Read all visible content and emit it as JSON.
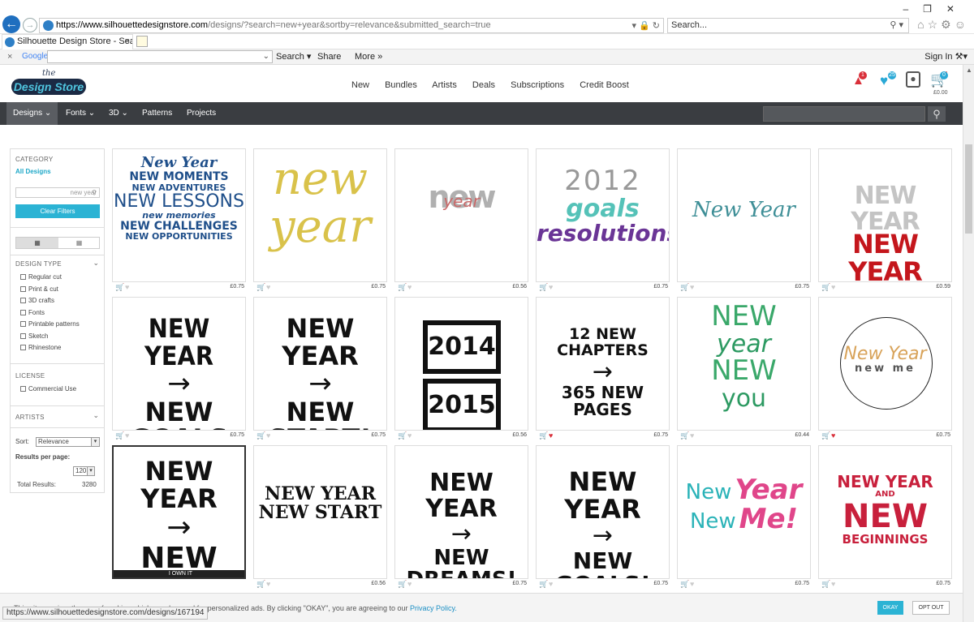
{
  "browser": {
    "url_host": "https://www.silhouettedesignstore.com",
    "url_path": "/designs/?search=new+year&sortby=relevance&submitted_search=true",
    "search_placeholder": "Search...",
    "tab_title": "Silhouette Design Store - Sea...",
    "tab_close": "×",
    "toolbar": {
      "google": "Google",
      "search": "Search",
      "share": "Share",
      "more": "More »",
      "signin": "Sign In"
    },
    "status_url": "https://www.silhouettedesignstore.com/designs/167194"
  },
  "site": {
    "logo_the": "the",
    "logo_text": "Design Store",
    "nav": [
      "New",
      "Bundles",
      "Artists",
      "Deals",
      "Subscriptions",
      "Credit Boost"
    ],
    "notifications": "1",
    "favorites": "25",
    "cart_count": "0",
    "cart_total": "£0.00",
    "categories": [
      "Designs ⌄",
      "Fonts ⌄",
      "3D ⌄",
      "Patterns",
      "Projects"
    ]
  },
  "sidebar": {
    "category_title": "CATEGORY",
    "all_designs": "All Designs",
    "search_value": "new year",
    "clear_filters": "Clear Filters",
    "design_type_title": "DESIGN TYPE",
    "design_types": [
      "Regular cut",
      "Print & cut",
      "3D crafts",
      "Fonts",
      "Printable patterns",
      "Sketch",
      "Rhinestone"
    ],
    "license_title": "LICENSE",
    "license_options": [
      "Commercial Use"
    ],
    "artists_title": "ARTISTS",
    "sort_label": "Sort:",
    "sort_value": "Relevance",
    "rpp_label": "Results per page:",
    "rpp_value": "120",
    "total_label": "Total Results:",
    "total_value": "3280"
  },
  "designs": [
    {
      "price": "£0.75",
      "lines": [
        "New Year",
        "NEW MOMENTS",
        "NEW ADVENTURES",
        "NEW LESSONS",
        "new memories",
        "NEW CHALLENGES",
        "NEW OPPORTUNITIES"
      ],
      "color": "#1f4f8a",
      "fav": false
    },
    {
      "price": "£0.75",
      "lines": [
        "new",
        "year"
      ],
      "color": "#d9c24a",
      "fav": false
    },
    {
      "price": "£0.56",
      "lines": [
        "new",
        "year"
      ],
      "color": "#b0b0b0",
      "accent": "#c96a6a",
      "fav": false
    },
    {
      "price": "£0.75",
      "lines": [
        "2012",
        "goals",
        "resolutions"
      ],
      "color": "#999",
      "accent": "#55c2b8",
      "accent2": "#6a3596",
      "fav": false
    },
    {
      "price": "£0.75",
      "lines": [
        "New Year"
      ],
      "color": "#3f8f97",
      "fav": false
    },
    {
      "price": "£0.59",
      "lines": [
        "NEW YEAR",
        "NEW YEAR"
      ],
      "color": "#c4c4c4",
      "accent": "#c4161c",
      "fav": false
    },
    {
      "price": "£0.75",
      "lines": [
        "NEW YEAR",
        "→",
        "NEW GOALS"
      ],
      "color": "#111",
      "fav": false
    },
    {
      "price": "£0.75",
      "lines": [
        "NEW YEAR",
        "→",
        "NEW START!"
      ],
      "color": "#111",
      "fav": false
    },
    {
      "price": "£0.56",
      "lines": [
        "2014",
        "2015"
      ],
      "color": "#111",
      "fav": false
    },
    {
      "price": "£0.75",
      "lines": [
        "12 NEW CHAPTERS",
        "→",
        "365 NEW PAGES"
      ],
      "color": "#111",
      "fav": true
    },
    {
      "price": "£0.44",
      "lines": [
        "NEW",
        "year",
        "NEW",
        "you"
      ],
      "color": "#3aa86a",
      "fav": false
    },
    {
      "price": "£0.75",
      "lines": [
        "New Year",
        "new me"
      ],
      "color": "#d8a35a",
      "fav": true
    },
    {
      "price": "",
      "lines": [
        "NEW YEAR",
        "→",
        "NEW ME"
      ],
      "color": "#111",
      "fav": false,
      "banner": "I OWN IT"
    },
    {
      "price": "£0.56",
      "lines": [
        "NEW YEAR",
        "NEW START"
      ],
      "color": "#111",
      "fav": false
    },
    {
      "price": "£0.75",
      "lines": [
        "NEW YEAR",
        "→",
        "NEW DREAMS!"
      ],
      "color": "#111",
      "fav": false
    },
    {
      "price": "£0.75",
      "lines": [
        "NEW YEAR",
        "→",
        "NEW GOALS!"
      ],
      "color": "#111",
      "fav": false
    },
    {
      "price": "£0.75",
      "lines": [
        "New",
        "Year",
        "New",
        "Me!"
      ],
      "color": "#2bb3b8",
      "accent": "#e0468a",
      "fav": false
    },
    {
      "price": "£0.75",
      "lines": [
        "NEW YEAR",
        "AND",
        "NEW",
        "BEGINNINGS"
      ],
      "color": "#c8203c",
      "fav": false
    }
  ],
  "cookie": {
    "text": "This site requires the use of cookies which may be used for personalized ads. By clicking \"OKAY\", you are agreeing to our",
    "policy": "Privacy Policy.",
    "okay": "OKAY",
    "optout": "OPT OUT"
  }
}
